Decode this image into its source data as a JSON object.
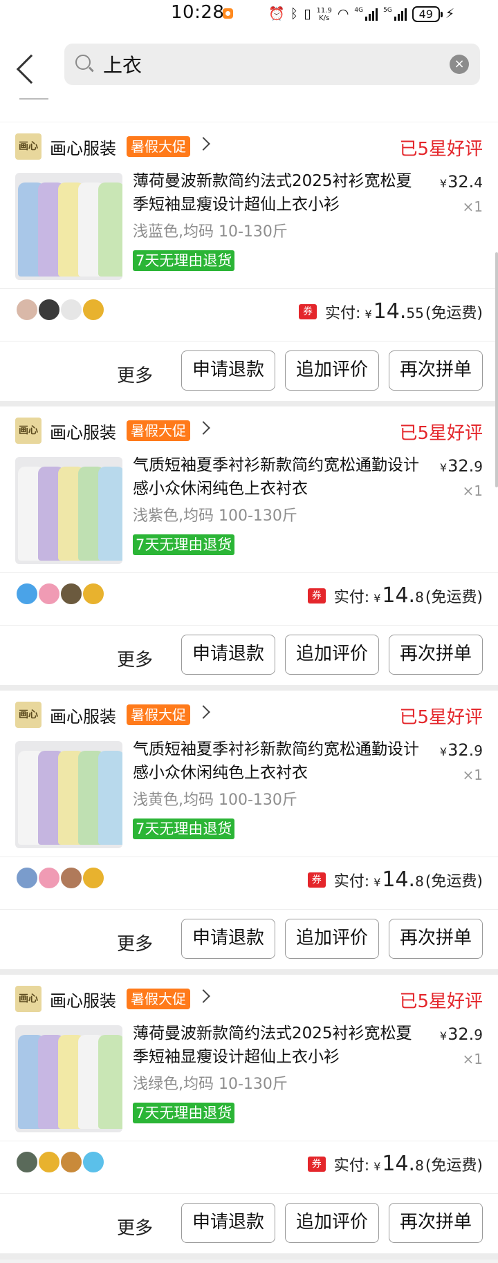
{
  "status_bar": {
    "time": "10:28",
    "net_speed_value": "11.9",
    "net_speed_unit": "K/s",
    "sig1_tag": "4G",
    "sig2_tag": "5G",
    "battery": "49"
  },
  "search": {
    "query": "上衣",
    "clear_icon": "×"
  },
  "orders": [
    {
      "shop_logo": "画心",
      "shop_name": "画心服装",
      "promo": "暑假大促",
      "review_status": "已5星好评",
      "title": "薄荷曼波新款简约法式2025衬衫宽松夏季短袖显瘦设计超仙上衣小衫",
      "variant": "浅蓝色,均码 10-130斤",
      "return_policy": "7天无理由退货",
      "unit_price_yen": "¥",
      "unit_price_int": "32.",
      "unit_price_dec": "4",
      "qty": "×1",
      "coupon": "券",
      "pay_label": "实付:",
      "pay_yen": "¥",
      "pay_int": "14.",
      "pay_dec": "55",
      "pay_note": "(免运费)",
      "more": "更多",
      "btn_refund": "申请退款",
      "btn_review": "追加评价",
      "btn_reorder": "再次拼单",
      "shirt_colors": [
        "#a9c7e8",
        "#c7b7e3",
        "#f2e9a6",
        "#f3f3f3",
        "#c9e6b5"
      ],
      "avatar_colors": [
        "#d9b8a8",
        "#3a3a3a",
        "#e6e6e6",
        "#e8b22e"
      ]
    },
    {
      "shop_logo": "画心",
      "shop_name": "画心服装",
      "promo": "暑假大促",
      "review_status": "已5星好评",
      "title": "气质短袖夏季衬衫新款简约宽松通勤设计感小众休闲纯色上衣衬衣",
      "variant": "浅紫色,均码 100-130斤",
      "return_policy": "7天无理由退货",
      "unit_price_yen": "¥",
      "unit_price_int": "32.",
      "unit_price_dec": "9",
      "qty": "×1",
      "coupon": "券",
      "pay_label": "实付:",
      "pay_yen": "¥",
      "pay_int": "14.",
      "pay_dec": "8",
      "pay_note": "(免运费)",
      "more": "更多",
      "btn_refund": "申请退款",
      "btn_review": "追加评价",
      "btn_reorder": "再次拼单",
      "shirt_colors": [
        "#f4f4f4",
        "#c5b5e0",
        "#efe7a8",
        "#bfe0b2",
        "#b8d9ec"
      ],
      "avatar_colors": [
        "#4aa3e8",
        "#f09bb4",
        "#6b5a3e",
        "#e8b22e"
      ]
    },
    {
      "shop_logo": "画心",
      "shop_name": "画心服装",
      "promo": "暑假大促",
      "review_status": "已5星好评",
      "title": "气质短袖夏季衬衫新款简约宽松通勤设计感小众休闲纯色上衣衬衣",
      "variant": "浅黄色,均码 100-130斤",
      "return_policy": "7天无理由退货",
      "unit_price_yen": "¥",
      "unit_price_int": "32.",
      "unit_price_dec": "9",
      "qty": "×1",
      "coupon": "券",
      "pay_label": "实付:",
      "pay_yen": "¥",
      "pay_int": "14.",
      "pay_dec": "8",
      "pay_note": "(免运费)",
      "more": "更多",
      "btn_refund": "申请退款",
      "btn_review": "追加评价",
      "btn_reorder": "再次拼单",
      "shirt_colors": [
        "#f4f4f4",
        "#c5b5e0",
        "#efe7a8",
        "#bfe0b2",
        "#b8d9ec"
      ],
      "avatar_colors": [
        "#7a9ccc",
        "#f09bb4",
        "#b07a5a",
        "#e8b22e"
      ]
    },
    {
      "shop_logo": "画心",
      "shop_name": "画心服装",
      "promo": "暑假大促",
      "review_status": "已5星好评",
      "title": "薄荷曼波新款简约法式2025衬衫宽松夏季短袖显瘦设计超仙上衣小衫",
      "variant": "浅绿色,均码 10-130斤",
      "return_policy": "7天无理由退货",
      "unit_price_yen": "¥",
      "unit_price_int": "32.",
      "unit_price_dec": "9",
      "qty": "×1",
      "coupon": "券",
      "pay_label": "实付:",
      "pay_yen": "¥",
      "pay_int": "14.",
      "pay_dec": "8",
      "pay_note": "(免运费)",
      "more": "更多",
      "btn_refund": "申请退款",
      "btn_review": "追加评价",
      "btn_reorder": "再次拼单",
      "shirt_colors": [
        "#a9c7e8",
        "#c7b7e3",
        "#f2e9a6",
        "#f3f3f3",
        "#c9e6b5"
      ],
      "avatar_colors": [
        "#5a6a5a",
        "#e8b22e",
        "#c98a3a",
        "#5bc0ea"
      ]
    }
  ],
  "colors": {
    "accent_red": "#e4262b",
    "promo_orange": "#ff7a1a",
    "return_green": "#2bb536"
  }
}
